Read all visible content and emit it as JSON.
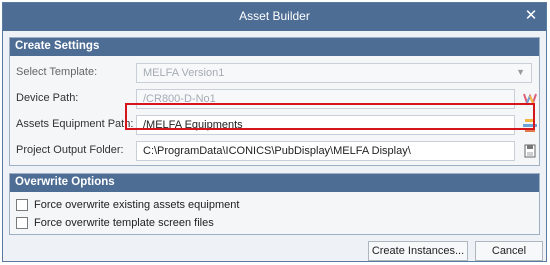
{
  "window": {
    "title": "Asset Builder",
    "close_glyph": "✕"
  },
  "create_settings": {
    "header": "Create Settings",
    "template_label": "Select Template:",
    "template_value": "MELFA Version1",
    "device_path_label": "Device Path:",
    "device_path_value": "/CR800-D-No1",
    "assets_path_label": "Assets Equipment Path:",
    "assets_path_value": "/MELFA Equipments",
    "output_folder_label": "Project Output Folder:",
    "output_folder_value": "C:\\ProgramData\\ICONICS\\PubDisplay\\MELFA Display\\"
  },
  "overwrite_options": {
    "header": "Overwrite Options",
    "option_1": "Force overwrite existing assets equipment",
    "option_1_checked": false,
    "option_2": "Force overwrite template screen files",
    "option_2_checked": false
  },
  "footer": {
    "create_label": "Create Instances...",
    "cancel_label": "Cancel"
  },
  "colors": {
    "accent": "#4d6d95",
    "highlight": "#d6141c"
  },
  "icons": [
    "close-icon",
    "chevron-down-icon",
    "device-tag-icon",
    "assets-tree-icon",
    "folder-save-icon"
  ]
}
